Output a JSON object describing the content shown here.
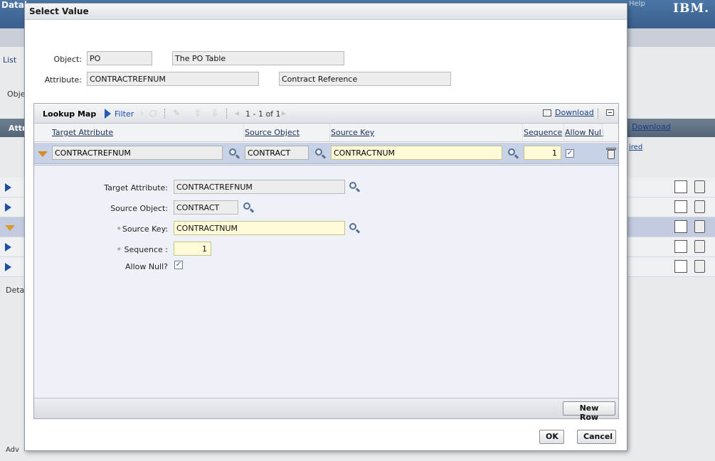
{
  "background": {
    "app_title": "Datab",
    "help_link": "Help",
    "brand": "IBM.",
    "list_tab": "List",
    "object_label": "Obje",
    "attributes_label": "Attr",
    "download_label": "Download",
    "required_label": "ired",
    "details_label": "Deta",
    "advanced_label": "Adv"
  },
  "dialog": {
    "title": "Select Value",
    "object": {
      "label": "Object:",
      "value": "PO",
      "description": "The PO Table"
    },
    "attribute": {
      "label": "Attribute:",
      "value": "CONTRACTREFNUM",
      "description": "Contract Reference"
    },
    "lookup_map": {
      "title": "Lookup Map",
      "filter_label": "Filter",
      "count_text": "1 - 1 of 1",
      "download_label": "Download",
      "columns": {
        "target_attribute": "Target Attribute",
        "source_object": "Source Object",
        "source_key": "Source Key",
        "sequence": "Sequence",
        "allow_null": "Allow Null"
      },
      "row": {
        "target_attribute": "CONTRACTREFNUM",
        "source_object": "CONTRACT",
        "source_key": "CONTRACTNUM",
        "sequence": "1",
        "allow_null": true
      },
      "details": {
        "target_attribute_label": "Target Attribute:",
        "target_attribute_value": "CONTRACTREFNUM",
        "source_object_label": "Source Object:",
        "source_object_value": "CONTRACT",
        "source_key_label": "Source Key:",
        "source_key_value": "CONTRACTNUM",
        "sequence_label": "Sequence :",
        "sequence_value": "1",
        "allow_null_label": "Allow Null?",
        "required_marker": "*"
      },
      "new_row_label": "New Row"
    },
    "ok_label": "OK",
    "cancel_label": "Cancel"
  },
  "icons": {
    "check_mark": "✓"
  },
  "colors": {
    "header_blue": "#3a5f8c",
    "selected_row": "#c8d2e6",
    "required_field": "#fffbd8",
    "link_blue": "#1a3f84"
  }
}
